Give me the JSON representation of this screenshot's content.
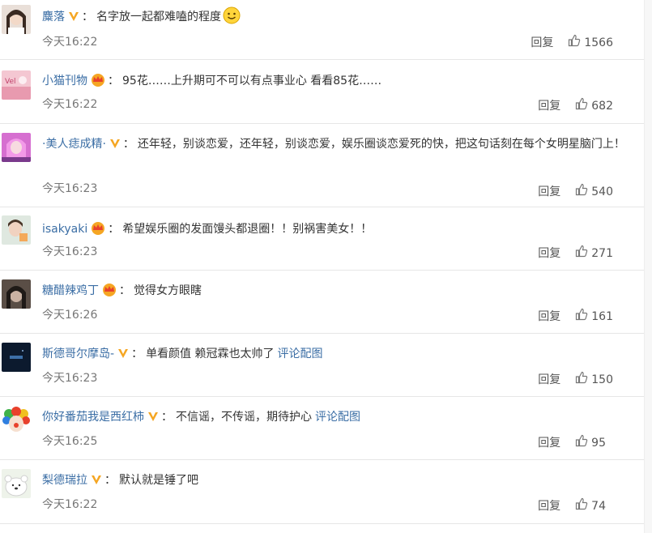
{
  "comments": [
    {
      "name": "麋落",
      "text": "名字放一起都难嗑的程度",
      "extra": "",
      "time": "今天16:22",
      "reply": "回复",
      "likes": "1566"
    },
    {
      "name": "小猫刊物",
      "text": "95花……上升期可不可以有点事业心 看看85花……",
      "extra": "",
      "time": "今天16:22",
      "reply": "回复",
      "likes": "682"
    },
    {
      "name": "·美人痣成精·",
      "text": "还年轻，别谈恋爱，还年轻，别谈恋爱，娱乐圈谈恋爱死的快，把这句话刻在每个女明星脑门上！",
      "extra": "",
      "time": "今天16:23",
      "reply": "回复",
      "likes": "540"
    },
    {
      "name": "isakyaki",
      "text": "希望娱乐圈的发面馒头都退圈！！别祸害美女！！",
      "extra": "",
      "time": "今天16:23",
      "reply": "回复",
      "likes": "271"
    },
    {
      "name": "糖醋辣鸡丁",
      "text": "觉得女方眼瞎",
      "extra": "",
      "time": "今天16:26",
      "reply": "回复",
      "likes": "161"
    },
    {
      "name": "斯德哥尔摩岛-",
      "text": "单看颜值 赖冠霖也太帅了",
      "extra": "评论配图",
      "time": "今天16:23",
      "reply": "回复",
      "likes": "150"
    },
    {
      "name": "你好番茄我是西红柿",
      "text": "不信谣，不传谣，期待护心",
      "extra": "评论配图",
      "time": "今天16:25",
      "reply": "回复",
      "likes": "95"
    },
    {
      "name": "梨德瑞拉",
      "text": "默认就是锤了吧",
      "extra": "",
      "time": "今天16:22",
      "reply": "回复",
      "likes": "74"
    }
  ],
  "colors": {
    "name": "#3b6ea5",
    "badge_v": "#f5a623",
    "badge_crown": "#e8412c",
    "divider": "#e6e6e6"
  }
}
